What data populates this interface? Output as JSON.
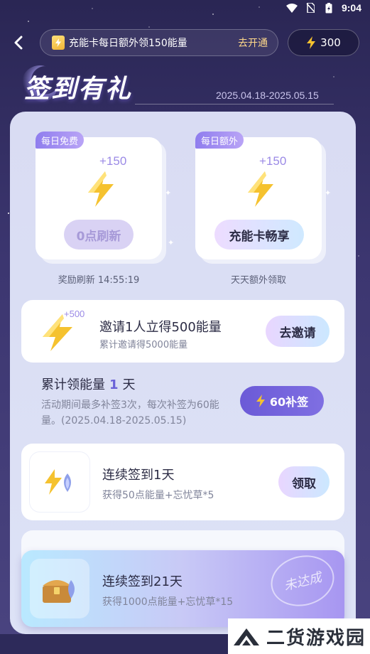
{
  "status_bar": {
    "time": "9:04"
  },
  "header": {
    "banner_text": "充能卡每日额外领150能量",
    "banner_cta": "去开通",
    "energy_balance": "300"
  },
  "title": {
    "text": "签到有礼",
    "date_range": "2025.04.18-2025.05.15"
  },
  "daily": [
    {
      "tag": "每日免费",
      "amount": "+150",
      "button": "0点刷新",
      "caption": "奖励刷新 14:55:19"
    },
    {
      "tag": "每日额外",
      "amount": "+150",
      "button": "充能卡畅享",
      "caption": "天天额外领取"
    }
  ],
  "invite": {
    "badge": "+500",
    "title": "邀请1人立得500能量",
    "subtitle": "累计邀请得5000能量",
    "button": "去邀请"
  },
  "cumulative": {
    "prefix": "累计领能量",
    "days": "1",
    "suffix": "天",
    "description": "活动期间最多补签3次，每次补签为60能量。(2025.04.18-2025.05.15)",
    "makeup_button": "60补签"
  },
  "streaks": [
    {
      "title": "连续签到1天",
      "reward": "获得50点能量+忘忧草*5",
      "button": "领取"
    },
    {
      "title": "连续签到21天",
      "reward": "获得1000点能量+忘忧草*15",
      "stamp": "未达成"
    }
  ],
  "watermark": {
    "text": "二货游戏园"
  },
  "colors": {
    "background": "#2a2654",
    "panel": "#d9dcf3",
    "accent": "#6b5ad7",
    "energy_bolt": "#f5c22f"
  },
  "icons": {
    "back": "chevron-left-icon",
    "energy": "lightning-bolt-icon",
    "card": "energy-card-icon",
    "treasure": "treasure-chest-icon"
  }
}
